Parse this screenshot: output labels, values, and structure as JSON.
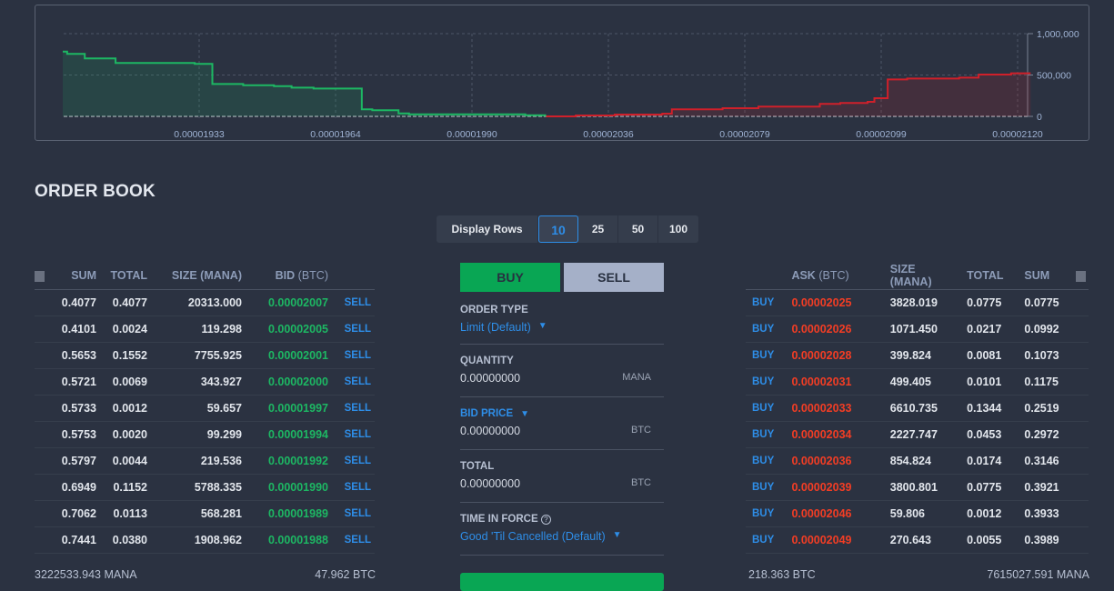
{
  "chart_data": {
    "type": "area",
    "title": "",
    "x_ticks": [
      "0.00001933",
      "0.00001964",
      "0.00001990",
      "0.00002036",
      "0.00002079",
      "0.00002099",
      "0.00002120"
    ],
    "y_ticks": [
      "1,000,000",
      "500,000",
      "0"
    ],
    "ylim": [
      0,
      1000000
    ],
    "grid": true,
    "series": [
      {
        "side": "bid",
        "color": "#1db763",
        "step_points": [
          [
            1.902e-05,
            783000
          ],
          [
            1.903e-05,
            755000
          ],
          [
            1.907e-05,
            700000
          ],
          [
            1.914e-05,
            645000
          ],
          [
            1.932e-05,
            634000
          ],
          [
            1.936e-05,
            392000
          ],
          [
            1.943e-05,
            377000
          ],
          [
            1.95e-05,
            366000
          ],
          [
            1.954e-05,
            348000
          ],
          [
            1.959e-05,
            337000
          ],
          [
            1.969e-05,
            85000
          ],
          [
            1.971e-05,
            74000
          ],
          [
            1.976e-05,
            36000
          ],
          [
            1.978e-05,
            25000
          ],
          [
            2.008e-05,
            14000
          ],
          [
            2.015e-05,
            14000
          ]
        ]
      },
      {
        "side": "ask",
        "color": "#d0202a",
        "step_points": [
          [
            2.015e-05,
            0
          ],
          [
            2.025e-05,
            11000
          ],
          [
            2.038e-05,
            22000
          ],
          [
            2.053e-05,
            33000
          ],
          [
            2.056e-05,
            85000
          ],
          [
            2.072e-05,
            99000
          ],
          [
            2.081e-05,
            118000
          ],
          [
            2.09e-05,
            151000
          ],
          [
            2.093e-05,
            162000
          ],
          [
            2.097e-05,
            176000
          ],
          [
            2.098e-05,
            220000
          ],
          [
            2.1e-05,
            447000
          ],
          [
            2.103e-05,
            458000
          ],
          [
            2.111e-05,
            469000
          ],
          [
            2.114e-05,
            505000
          ],
          [
            2.119e-05,
            520000
          ],
          [
            2.122e-05,
            520000
          ]
        ]
      }
    ]
  },
  "title": "ORDER BOOK",
  "display_rows": {
    "label": "Display Rows",
    "options": [
      "10",
      "25",
      "50",
      "100"
    ],
    "selected": "10"
  },
  "bids": {
    "headers": [
      "SUM",
      "TOTAL",
      "SIZE (MANA)",
      "BID",
      "(BTC)"
    ],
    "action": "SELL",
    "rows": [
      [
        "0.4077",
        "0.4077",
        "20313.000",
        "0.00002007"
      ],
      [
        "0.4101",
        "0.0024",
        "119.298",
        "0.00002005"
      ],
      [
        "0.5653",
        "0.1552",
        "7755.925",
        "0.00002001"
      ],
      [
        "0.5721",
        "0.0069",
        "343.927",
        "0.00002000"
      ],
      [
        "0.5733",
        "0.0012",
        "59.657",
        "0.00001997"
      ],
      [
        "0.5753",
        "0.0020",
        "99.299",
        "0.00001994"
      ],
      [
        "0.5797",
        "0.0044",
        "219.536",
        "0.00001992"
      ],
      [
        "0.6949",
        "0.1152",
        "5788.335",
        "0.00001990"
      ],
      [
        "0.7062",
        "0.0113",
        "568.281",
        "0.00001989"
      ],
      [
        "0.7441",
        "0.0380",
        "1908.962",
        "0.00001988"
      ]
    ],
    "footer_left": "3222533.943 MANA",
    "footer_right": "47.962 BTC"
  },
  "asks": {
    "headers": [
      "ASK",
      "(BTC)",
      "SIZE (MANA)",
      "TOTAL",
      "SUM"
    ],
    "action": "BUY",
    "rows": [
      [
        "0.00002025",
        "3828.019",
        "0.0775",
        "0.0775"
      ],
      [
        "0.00002026",
        "1071.450",
        "0.0217",
        "0.0992"
      ],
      [
        "0.00002028",
        "399.824",
        "0.0081",
        "0.1073"
      ],
      [
        "0.00002031",
        "499.405",
        "0.0101",
        "0.1175"
      ],
      [
        "0.00002033",
        "6610.735",
        "0.1344",
        "0.2519"
      ],
      [
        "0.00002034",
        "2227.747",
        "0.0453",
        "0.2972"
      ],
      [
        "0.00002036",
        "854.824",
        "0.0174",
        "0.3146"
      ],
      [
        "0.00002039",
        "3800.801",
        "0.0775",
        "0.3921"
      ],
      [
        "0.00002046",
        "59.806",
        "0.0012",
        "0.3933"
      ],
      [
        "0.00002049",
        "270.643",
        "0.0055",
        "0.3989"
      ]
    ],
    "footer_left": "218.363 BTC",
    "footer_right": "7615027.591 MANA"
  },
  "form": {
    "buy": "BUY",
    "sell": "SELL",
    "order_type_label": "ORDER TYPE",
    "order_type_value": "Limit (Default)",
    "quantity_label": "QUANTITY",
    "quantity_value": "0.00000000",
    "quantity_unit": "MANA",
    "price_label": "BID PRICE",
    "price_value": "0.00000000",
    "price_unit": "BTC",
    "total_label": "TOTAL",
    "total_value": "0.00000000",
    "total_unit": "BTC",
    "tif_label": "TIME IN FORCE",
    "tif_value": "Good 'Til Cancelled (Default)"
  }
}
